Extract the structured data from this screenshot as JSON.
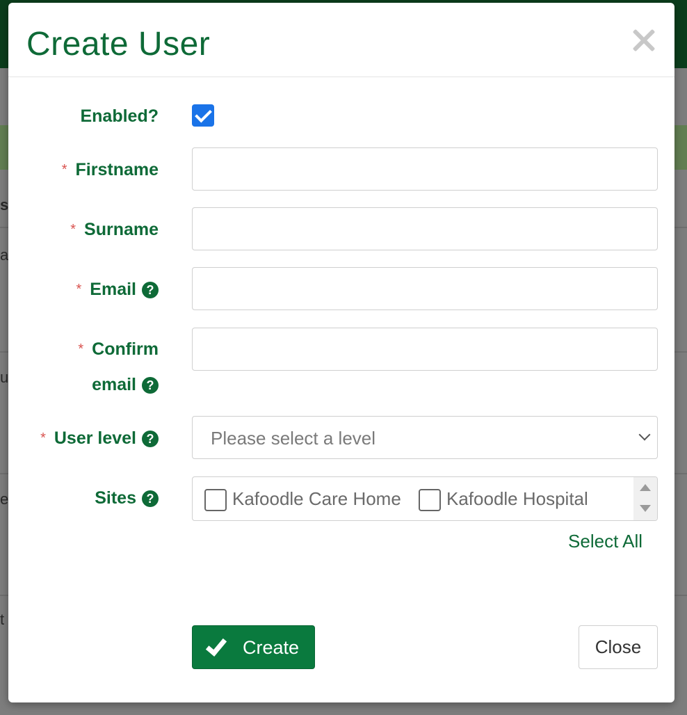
{
  "background": {
    "fragments": [
      "s",
      "a",
      "u",
      "e",
      "t"
    ]
  },
  "modal": {
    "title": "Create User",
    "required_marker": "*",
    "help_glyph": "?",
    "fields": {
      "enabled": {
        "label": "Enabled?",
        "checked": true
      },
      "firstname": {
        "label": "Firstname",
        "value": ""
      },
      "surname": {
        "label": "Surname",
        "value": ""
      },
      "email": {
        "label": "Email",
        "value": ""
      },
      "confirm_email": {
        "label_line1": "Confirm",
        "label_line2": "email",
        "value": ""
      },
      "user_level": {
        "label": "User level",
        "placeholder": "Please select a level"
      },
      "sites": {
        "label": "Sites",
        "options": [
          {
            "label": "Kafoodle Care Home",
            "checked": false
          },
          {
            "label": "Kafoodle Hospital",
            "checked": false
          }
        ],
        "select_all_label": "Select All"
      }
    },
    "buttons": {
      "create_label": "Create",
      "close_label": "Close"
    }
  },
  "colors": {
    "brand_green": "#0e6a37",
    "button_green": "#0a7a3e",
    "required_red": "#d9534f",
    "checkbox_blue": "#1a73e8"
  }
}
